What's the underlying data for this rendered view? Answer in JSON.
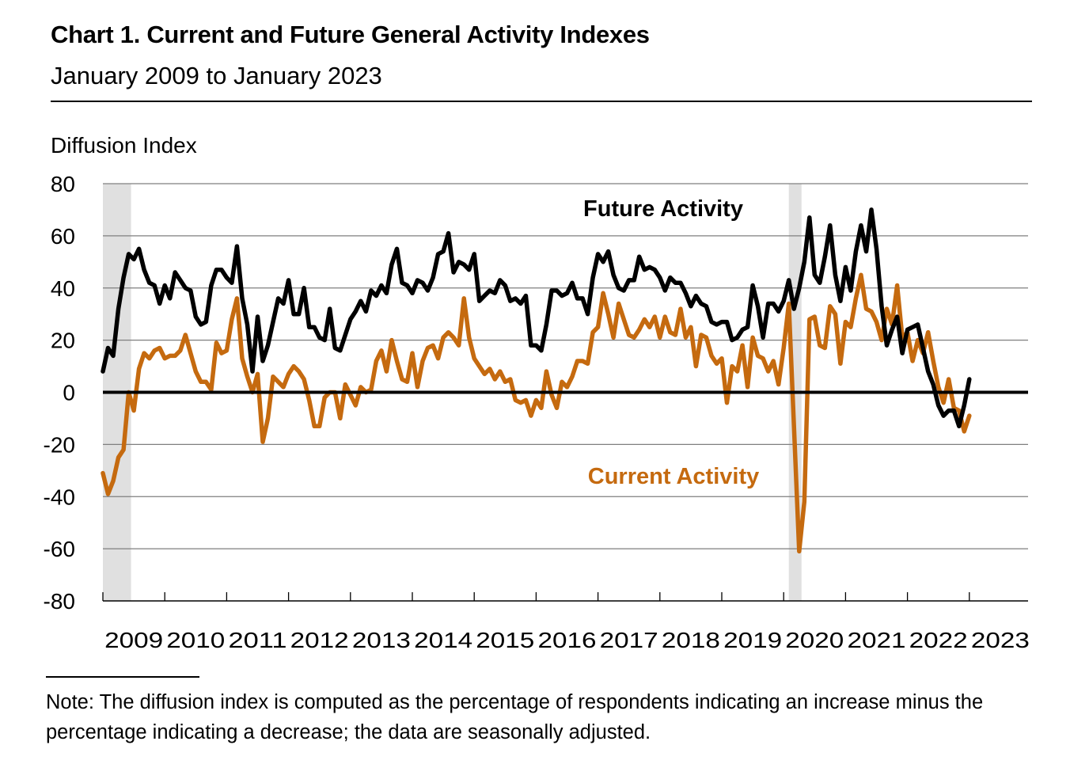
{
  "header": {
    "title": "Chart 1. Current and Future General Activity Indexes",
    "subtitle": "January 2009 to January 2023",
    "y_axis_label": "Diffusion Index"
  },
  "footer": {
    "note": "Note: The diffusion index is computed as the percentage of respondents indicating an increase minus the percentage indicating a decrease; the data are seasonally adjusted."
  },
  "chart_data": {
    "type": "line",
    "title": "Chart 1. Current and Future General Activity Indexes",
    "subtitle": "January 2009 to January 2023",
    "xlabel": "",
    "ylabel": "Diffusion Index",
    "ylim": [
      -80,
      80
    ],
    "yticks": [
      80,
      60,
      40,
      20,
      0,
      -20,
      -40,
      -60,
      -80
    ],
    "ytick_labels": [
      "80",
      "60",
      "40",
      "20",
      "0",
      "-20",
      "-40",
      "-60",
      "-80"
    ],
    "xlim_years": [
      2009,
      2024
    ],
    "xtick_labels": [
      "2009",
      "2010",
      "2011",
      "2012",
      "2013",
      "2014",
      "2015",
      "2016",
      "2017",
      "2018",
      "2019",
      "2020",
      "2021",
      "2022",
      "2023"
    ],
    "x_start": "2009-01",
    "frequency": "monthly",
    "grid": true,
    "legend": "inline labels",
    "recessions": [
      {
        "start": "2009-01",
        "end": "2009-06"
      },
      {
        "start": "2020-02",
        "end": "2020-04"
      }
    ],
    "colors": {
      "future": "#000000",
      "current": "#C56A0F",
      "recession": "#E0E0E0",
      "grid": "#7F7F7F"
    },
    "series": [
      {
        "name": "Future Activity",
        "key": "future",
        "label_position": "upper middle-right",
        "values": [
          8,
          17,
          14,
          32,
          44,
          53,
          51,
          55,
          47,
          42,
          41,
          34,
          41,
          36,
          46,
          43,
          40,
          39,
          29,
          26,
          27,
          41,
          47,
          47,
          44,
          42,
          56,
          36,
          26,
          8,
          29,
          12,
          18,
          27,
          36,
          34,
          43,
          30,
          30,
          40,
          25,
          25,
          21,
          20,
          32,
          17,
          16,
          22,
          28,
          31,
          35,
          31,
          39,
          37,
          41,
          38,
          49,
          55,
          42,
          41,
          38,
          43,
          42,
          39,
          44,
          53,
          54,
          61,
          46,
          50,
          49,
          47,
          53,
          35,
          37,
          39,
          38,
          43,
          41,
          35,
          36,
          34,
          37,
          18,
          18,
          16,
          26,
          39,
          39,
          37,
          38,
          42,
          36,
          36,
          30,
          44,
          53,
          50,
          54,
          45,
          40,
          39,
          43,
          43,
          52,
          47,
          48,
          47,
          44,
          39,
          44,
          42,
          42,
          38,
          33,
          37,
          34,
          33,
          27,
          26,
          27,
          27,
          20,
          21,
          24,
          25,
          41,
          33,
          21,
          34,
          34,
          31,
          35,
          43,
          32,
          40,
          50,
          67,
          45,
          42,
          52,
          64,
          45,
          35,
          48,
          39,
          54,
          64,
          54,
          70,
          55,
          33,
          18,
          24,
          29,
          15,
          24,
          25,
          26,
          17,
          8,
          3,
          -5,
          -9,
          -7,
          -7,
          -13,
          -5,
          5
        ]
      },
      {
        "name": "Current Activity",
        "key": "current",
        "label_position": "lower middle-right",
        "values": [
          -31,
          -39,
          -34,
          -25,
          -22,
          0,
          -7,
          9,
          15,
          13,
          16,
          17,
          13,
          14,
          14,
          16,
          22,
          15,
          8,
          4,
          4,
          1,
          19,
          15,
          16,
          28,
          36,
          13,
          6,
          0,
          7,
          -19,
          -10,
          6,
          4,
          2,
          7,
          10,
          8,
          5,
          -3,
          -13,
          -13,
          -2,
          0,
          0,
          -10,
          3,
          -1,
          -5,
          2,
          0,
          1,
          12,
          16,
          8,
          20,
          12,
          5,
          4,
          15,
          2,
          12,
          17,
          18,
          13,
          21,
          23,
          21,
          18,
          36,
          21,
          13,
          10,
          7,
          9,
          5,
          8,
          4,
          5,
          -3,
          -4,
          -3,
          -9,
          -3,
          -6,
          8,
          -1,
          -6,
          4,
          2,
          6,
          12,
          12,
          11,
          23,
          25,
          38,
          30,
          21,
          34,
          28,
          22,
          21,
          24,
          28,
          25,
          29,
          21,
          29,
          23,
          22,
          32,
          21,
          25,
          10,
          22,
          21,
          14,
          11,
          13,
          -4,
          10,
          8,
          18,
          2,
          21,
          14,
          13,
          8,
          12,
          3,
          17,
          34,
          -13,
          -61,
          -42,
          28,
          29,
          18,
          17,
          33,
          30,
          11,
          27,
          25,
          36,
          45,
          32,
          31,
          27,
          20,
          32,
          26,
          41,
          21,
          23,
          12,
          20,
          15,
          23,
          12,
          2,
          -4,
          5,
          -6,
          -7,
          -15,
          -9
        ]
      }
    ]
  }
}
